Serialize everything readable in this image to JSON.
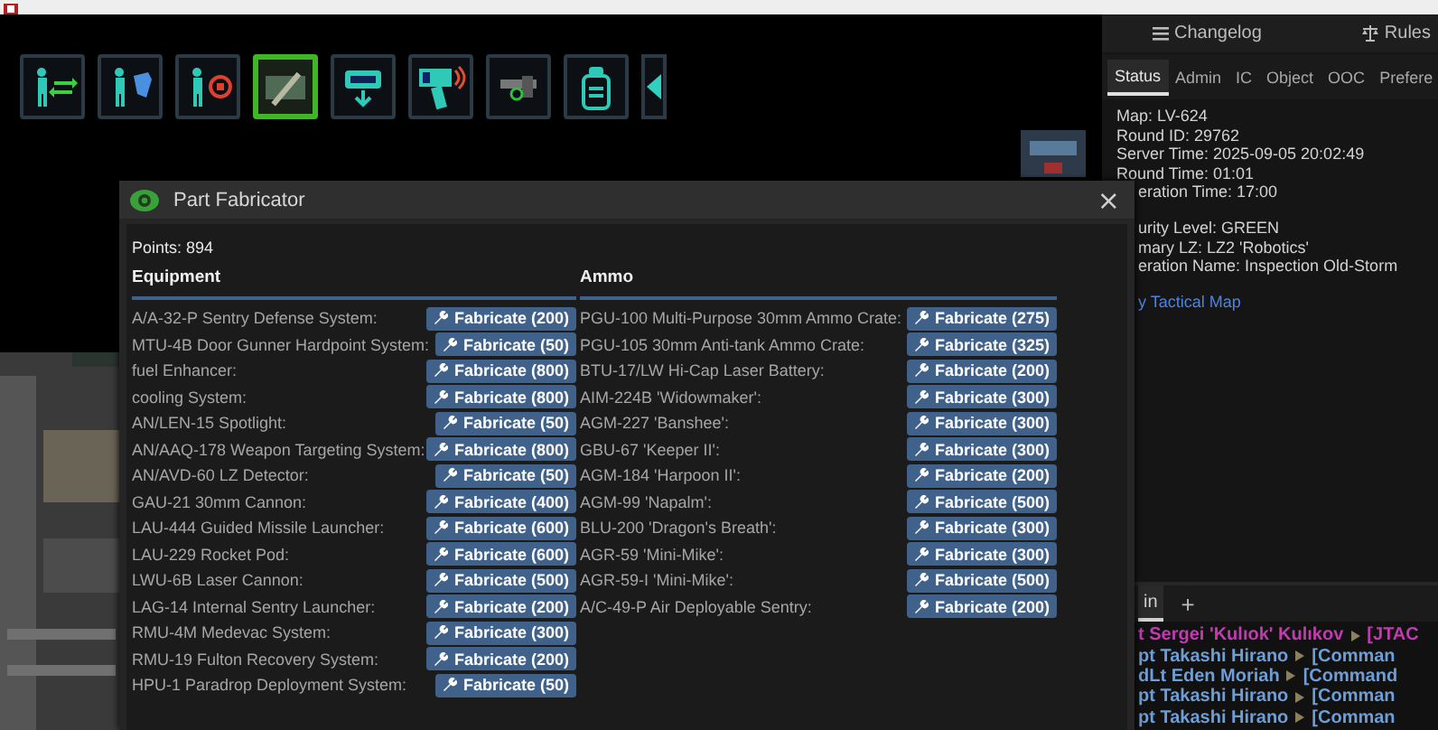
{
  "toolbar": [
    {
      "selected": false
    },
    {
      "selected": false
    },
    {
      "selected": false
    },
    {
      "selected": true
    },
    {
      "selected": false
    },
    {
      "selected": false
    },
    {
      "selected": false
    },
    {
      "selected": false
    }
  ],
  "fabricator": {
    "title": "Part Fabricator",
    "close": "×",
    "points": "Points: 894",
    "sections": [
      {
        "title": "Equipment",
        "items": [
          {
            "name": "A/A-32-P Sentry Defense System:",
            "button": "Fabricate (200)"
          },
          {
            "name": "MTU-4B Door Gunner Hardpoint System:",
            "button": "Fabricate (50)"
          },
          {
            "name": "fuel Enhancer:",
            "button": "Fabricate (800)"
          },
          {
            "name": "cooling System:",
            "button": "Fabricate (800)"
          },
          {
            "name": "AN/LEN-15 Spotlight:",
            "button": "Fabricate (50)"
          },
          {
            "name": "AN/AAQ-178 Weapon Targeting System:",
            "button": "Fabricate (800)"
          },
          {
            "name": "AN/AVD-60 LZ Detector:",
            "button": "Fabricate (50)"
          },
          {
            "name": "GAU-21 30mm Cannon:",
            "button": "Fabricate (400)"
          },
          {
            "name": "LAU-444 Guided Missile Launcher:",
            "button": "Fabricate (600)"
          },
          {
            "name": "LAU-229 Rocket Pod:",
            "button": "Fabricate (600)"
          },
          {
            "name": "LWU-6B Laser Cannon:",
            "button": "Fabricate (500)"
          },
          {
            "name": "LAG-14 Internal Sentry Launcher:",
            "button": "Fabricate (200)"
          },
          {
            "name": "RMU-4M Medevac System:",
            "button": "Fabricate (300)"
          },
          {
            "name": "RMU-19 Fulton Recovery System:",
            "button": "Fabricate (200)"
          },
          {
            "name": "HPU-1 Paradrop Deployment System:",
            "button": "Fabricate (50)"
          }
        ]
      },
      {
        "title": "Ammo",
        "items": [
          {
            "name": "PGU-100 Multi-Purpose 30mm Ammo Crate:",
            "button": "Fabricate (275)"
          },
          {
            "name": "PGU-105 30mm Anti-tank Ammo Crate:",
            "button": "Fabricate (325)"
          },
          {
            "name": "BTU-17/LW Hi-Cap Laser Battery:",
            "button": "Fabricate (200)"
          },
          {
            "name": "AIM-224B 'Widowmaker':",
            "button": "Fabricate (300)"
          },
          {
            "name": "AGM-227 'Banshee':",
            "button": "Fabricate (300)"
          },
          {
            "name": "GBU-67 'Keeper II':",
            "button": "Fabricate (300)"
          },
          {
            "name": "AGM-184 'Harpoon II':",
            "button": "Fabricate (200)"
          },
          {
            "name": "AGM-99 'Napalm':",
            "button": "Fabricate (500)"
          },
          {
            "name": "BLU-200 'Dragon's Breath':",
            "button": "Fabricate (300)"
          },
          {
            "name": "AGR-59 'Mini-Mike':",
            "button": "Fabricate (300)"
          },
          {
            "name": "AGR-59-I 'Mini-Mike':",
            "button": "Fabricate (500)"
          },
          {
            "name": "A/C-49-P Air Deployable Sentry:",
            "button": "Fabricate (200)"
          }
        ]
      }
    ]
  },
  "side_panel": {
    "links": [
      "Changelog",
      "Rules"
    ],
    "tabs": [
      {
        "label": "Status",
        "selected": true
      },
      {
        "label": "Admin",
        "selected": false
      },
      {
        "label": "IC",
        "selected": false
      },
      {
        "label": "Object",
        "selected": false
      },
      {
        "label": "OOC",
        "selected": false
      },
      {
        "label": "Prefere",
        "selected": false
      }
    ],
    "status_groups": [
      [
        {
          "kind": "text",
          "text": "Map: LV-624"
        },
        {
          "kind": "text",
          "text": "Round ID: 29762"
        },
        {
          "kind": "text",
          "text": "Server Time: 2025-09-05 20:02:49"
        },
        {
          "kind": "text",
          "text": "Round Time: 01:01"
        },
        {
          "kind": "text",
          "text": "eration Time: 17:00"
        }
      ],
      [
        {
          "kind": "text",
          "text": "urity Level: GREEN"
        },
        {
          "kind": "text",
          "text": "mary LZ: LZ2 'Robotics'"
        },
        {
          "kind": "text",
          "text": "eration Name: Inspection Old-Storm"
        }
      ],
      [
        {
          "kind": "link",
          "text": "y Tactical Map"
        }
      ]
    ]
  },
  "chat": {
    "tabs": [
      {
        "label": "in",
        "selected": true
      }
    ],
    "add": "+",
    "messages": [
      {
        "sender": "t Sergei 'Kulıok' Kulıkov",
        "channel": "[JTAC",
        "color": "#c03cb0"
      },
      {
        "sender": "pt Takashi Hirano",
        "channel": "[Comman",
        "color": "#6e9ed6"
      },
      {
        "sender": "dLt Eden Moriah",
        "channel": "[Command",
        "color": "#6e9ed6"
      },
      {
        "sender": "pt Takashi Hirano",
        "channel": "[Comman",
        "color": "#6e9ed6"
      },
      {
        "sender": "pt Takashi Hirano",
        "channel": "[Comman",
        "color": "#6e9ed6"
      }
    ]
  }
}
